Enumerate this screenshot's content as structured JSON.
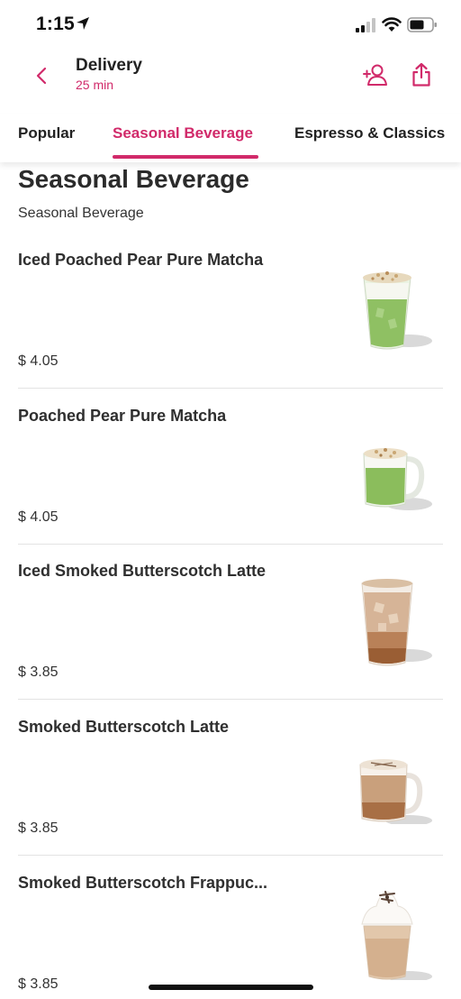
{
  "status_bar": {
    "time": "1:15"
  },
  "header": {
    "title": "Delivery",
    "subtitle": "25 min"
  },
  "tabs": [
    {
      "label": "Popular"
    },
    {
      "label": "Seasonal Beverage"
    },
    {
      "label": "Espresso & Classics"
    }
  ],
  "section": {
    "title": "Seasonal Beverage",
    "subtitle": "Seasonal Beverage"
  },
  "items": [
    {
      "name": "Iced Poached Pear Pure Matcha",
      "price": "$ 4.05"
    },
    {
      "name": "Poached Pear Pure Matcha",
      "price": "$ 4.05"
    },
    {
      "name": "Iced Smoked Butterscotch Latte",
      "price": "$ 3.85"
    },
    {
      "name": "Smoked Butterscotch Latte",
      "price": "$ 3.85"
    },
    {
      "name": "Smoked Butterscotch Frappuc...",
      "price": "$ 3.85"
    }
  ],
  "colors": {
    "accent": "#d12a6a",
    "text": "#2b2b2b",
    "divider": "#e3e3e3"
  }
}
